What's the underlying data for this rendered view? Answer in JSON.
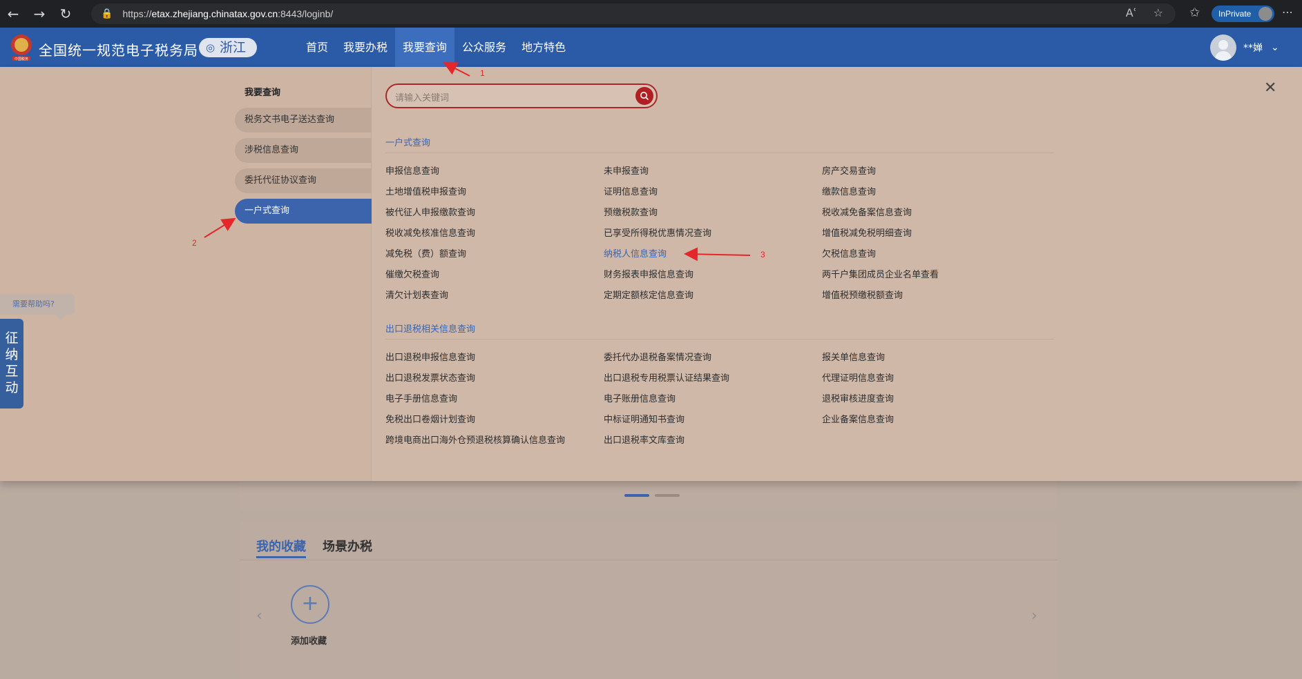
{
  "browser": {
    "url_prefix": "https://",
    "url_host": "etax.zhejiang.chinatax.gov.cn",
    "url_rest": ":8443/loginb/",
    "inprivate": "InPrivate"
  },
  "header": {
    "logo_text": "中国税务",
    "title": "全国统一规范电子税务局",
    "region": "浙江",
    "nav": [
      "首页",
      "我要办税",
      "我要查询",
      "公众服务",
      "地方特色"
    ],
    "user": "**婵"
  },
  "menu": {
    "title": "我要查询",
    "side_items": [
      "税务文书电子送达查询",
      "涉税信息查询",
      "委托代征协议查询",
      "一户式查询"
    ],
    "search_placeholder": "请输入关键词",
    "sections": [
      {
        "title": "一户式查询",
        "rows": [
          [
            "申报信息查询",
            "未申报查询",
            "房产交易查询"
          ],
          [
            "土地增值税申报查询",
            "证明信息查询",
            "缴款信息查询"
          ],
          [
            "被代征人申报缴款查询",
            "预缴税款查询",
            "税收减免备案信息查询"
          ],
          [
            "税收减免核准信息查询",
            "已享受所得税优惠情况查询",
            "增值税减免税明细查询"
          ],
          [
            "减免税（费）额查询",
            "纳税人信息查询",
            "欠税信息查询"
          ],
          [
            "催缴欠税查询",
            "财务报表申报信息查询",
            "两千户集团成员企业名单查看"
          ],
          [
            "清欠计划表查询",
            "定期定额核定信息查询",
            "增值税预缴税额查询"
          ]
        ]
      },
      {
        "title": "出口退税相关信息查询",
        "rows": [
          [
            "出口退税申报信息查询",
            "委托代办退税备案情况查询",
            "报关单信息查询"
          ],
          [
            "出口退税发票状态查询",
            "出口退税专用税票认证结果查询",
            "代理证明信息查询"
          ],
          [
            "电子手册信息查询",
            "电子账册信息查询",
            "退税审核进度查询"
          ],
          [
            "免税出口卷烟计划查询",
            "中标证明通知书查询",
            "企业备案信息查询"
          ],
          [
            "跨境电商出口海外仓预退税核算确认信息查询",
            "出口退税率文库查询"
          ]
        ]
      }
    ]
  },
  "help": {
    "bubble": "需要帮助吗?",
    "tab": "征纳互动"
  },
  "page": {
    "tabs": [
      "我的收藏",
      "场景办税"
    ],
    "add_label": "添加收藏"
  },
  "annotations": [
    "1",
    "2",
    "3"
  ],
  "colors": {
    "accent": "#2b5aa6",
    "annotation": "#e5262a",
    "search_border": "#a92726"
  }
}
